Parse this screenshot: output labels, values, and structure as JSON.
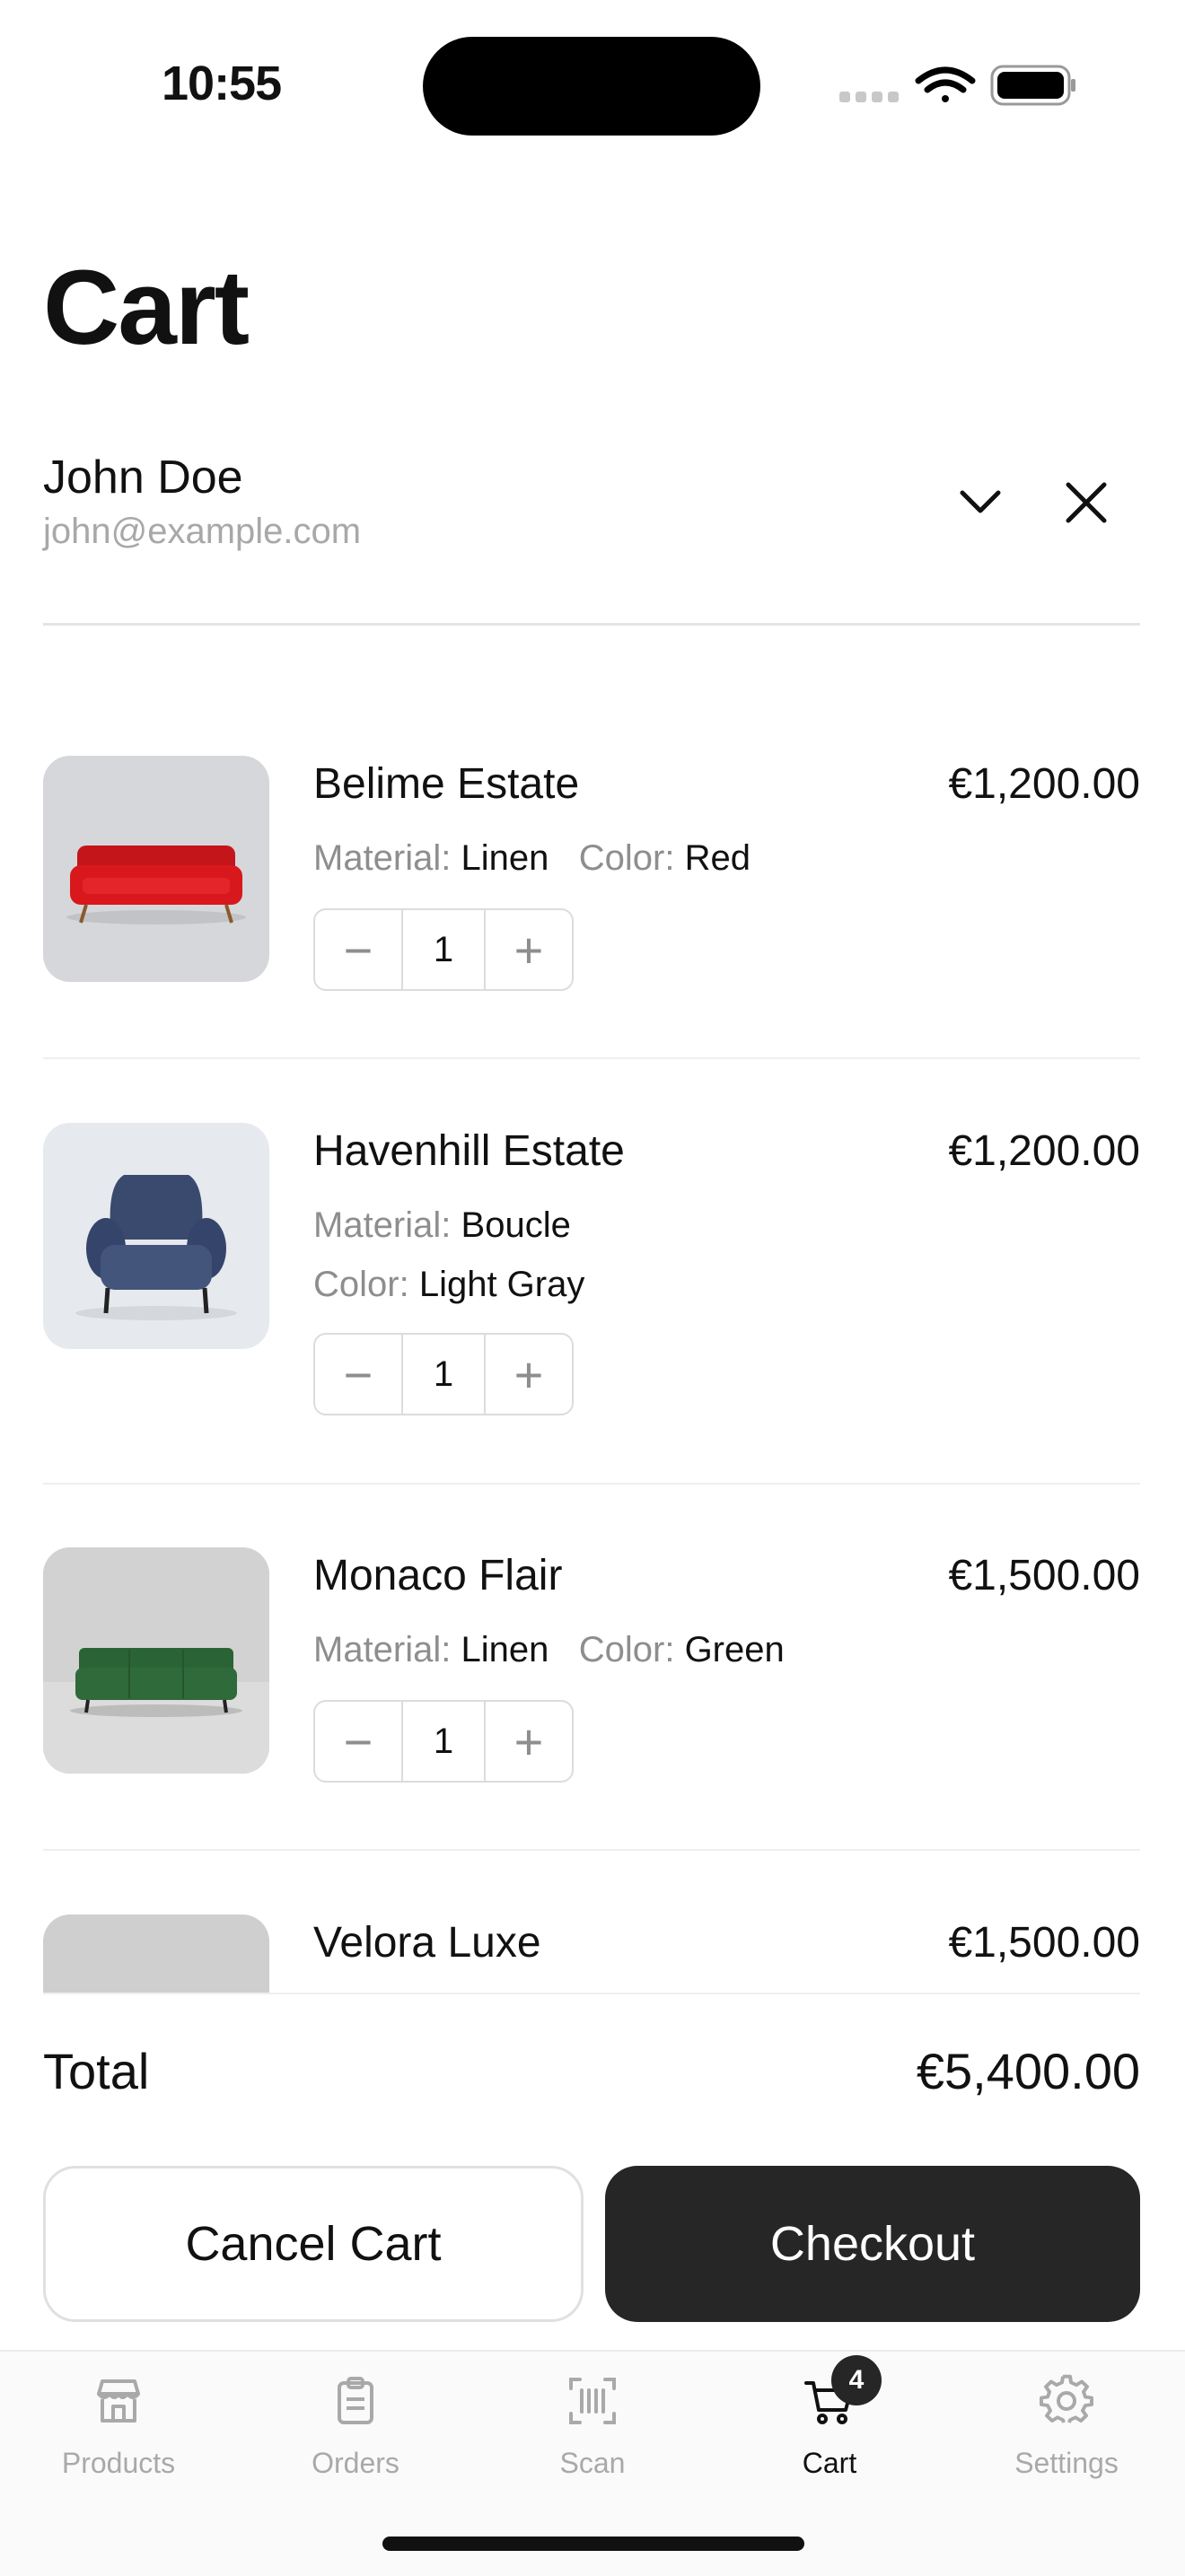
{
  "status": {
    "time": "10:55"
  },
  "page": {
    "title": "Cart"
  },
  "customer": {
    "name": "John Doe",
    "email": "john@example.com"
  },
  "items": [
    {
      "name": "Belime Estate",
      "price": "€1,200.00",
      "material_label": "Material:",
      "material": "Linen",
      "color_label": "Color:",
      "color": "Red",
      "qty": "1",
      "swatch": "#d8181c"
    },
    {
      "name": "Havenhill Estate",
      "price": "€1,200.00",
      "material_label": "Material:",
      "material": "Boucle",
      "color_label": "Color:",
      "color": "Light Gray",
      "qty": "1",
      "swatch": "#3f4f74"
    },
    {
      "name": "Monaco Flair",
      "price": "€1,500.00",
      "material_label": "Material:",
      "material": "Linen",
      "color_label": "Color:",
      "color": "Green",
      "qty": "1",
      "swatch": "#2f6b3a"
    },
    {
      "name": "Velora Luxe",
      "price": "€1,500.00"
    }
  ],
  "stepper": {
    "minus": "−",
    "plus": "+"
  },
  "summary": {
    "total_label": "Total",
    "total_value": "€5,400.00"
  },
  "actions": {
    "cancel": "Cancel Cart",
    "checkout": "Checkout"
  },
  "tabs": [
    {
      "label": "Products",
      "icon": "store-icon"
    },
    {
      "label": "Orders",
      "icon": "clipboard-icon"
    },
    {
      "label": "Scan",
      "icon": "barcode-scan-icon"
    },
    {
      "label": "Cart",
      "icon": "cart-icon",
      "badge": "4",
      "active": true
    },
    {
      "label": "Settings",
      "icon": "gear-icon"
    }
  ]
}
